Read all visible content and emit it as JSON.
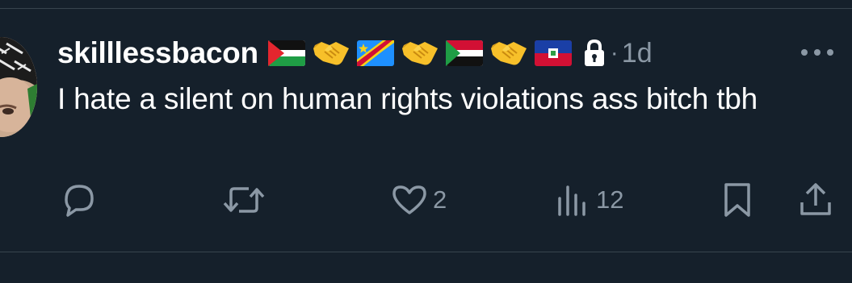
{
  "tweet": {
    "username": "skilllessbacon",
    "time_separator": "·",
    "time_ago": "1d",
    "text": "I hate a silent on human rights violations ass bitch tbh",
    "badges": [
      "flag-palestine-icon",
      "handshake-icon",
      "flag-dr-congo-icon",
      "handshake-icon",
      "flag-sudan-icon",
      "handshake-icon",
      "flag-haiti-icon"
    ],
    "protected": true
  },
  "actions": {
    "reply_count": "",
    "retweet_count": "",
    "like_count": "2",
    "views_count": "12"
  },
  "colors": {
    "background": "#15202b",
    "divider": "#38444d",
    "text_primary": "#ffffff",
    "text_secondary": "#8b98a5"
  }
}
